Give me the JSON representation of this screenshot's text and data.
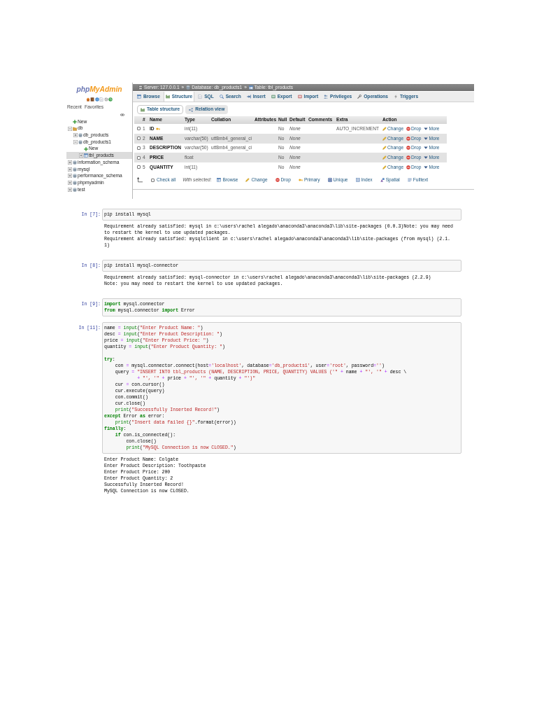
{
  "phpmyadmin": {
    "logo": {
      "prefix": "php",
      "name": "MyAdmin"
    },
    "panel_tabs": [
      "Recent",
      "Favorites"
    ],
    "tree": [
      {
        "kind": "new",
        "label": "New",
        "selected": false
      },
      {
        "kind": "group",
        "label": "db",
        "expanded": true,
        "selected": false,
        "children": [
          {
            "kind": "database",
            "label": "db_products",
            "expanded": false,
            "selected": false
          },
          {
            "kind": "database",
            "label": "db_products1",
            "expanded": true,
            "selected": false,
            "children": [
              {
                "kind": "new",
                "label": "New",
                "selected": false
              },
              {
                "kind": "table",
                "label": "tbl_products",
                "expanded": false,
                "selected": true
              }
            ]
          }
        ]
      },
      {
        "kind": "database",
        "label": "information_schema",
        "expanded": false,
        "selected": false
      },
      {
        "kind": "database",
        "label": "mysql",
        "expanded": false,
        "selected": false
      },
      {
        "kind": "database",
        "label": "performance_schema",
        "expanded": false,
        "selected": false
      },
      {
        "kind": "database",
        "label": "phpmyadmin",
        "expanded": false,
        "selected": false
      },
      {
        "kind": "database",
        "label": "test",
        "expanded": false,
        "selected": false
      }
    ],
    "breadcrumb": [
      {
        "kind": "server",
        "text": "Server: 127.0.0.1"
      },
      {
        "kind": "separator",
        "text": "»"
      },
      {
        "kind": "database",
        "text": "Database: db_products1"
      },
      {
        "kind": "separator",
        "text": "»"
      },
      {
        "kind": "table",
        "text": "Table: tbl_products"
      }
    ],
    "tabs": [
      {
        "label": "Browse",
        "selected": false
      },
      {
        "label": "Structure",
        "selected": true
      },
      {
        "label": "SQL",
        "selected": false
      },
      {
        "label": "Search",
        "selected": false
      },
      {
        "label": "Insert",
        "selected": false
      },
      {
        "label": "Export",
        "selected": false
      },
      {
        "label": "Import",
        "selected": false
      },
      {
        "label": "Privileges",
        "selected": false
      },
      {
        "label": "Operations",
        "selected": false
      },
      {
        "label": "Triggers",
        "selected": false
      }
    ],
    "subtabs": [
      {
        "label": "Table structure",
        "selected": true
      },
      {
        "label": "Relation view",
        "selected": false
      }
    ],
    "table": {
      "columns": [
        "#",
        "Name",
        "Type",
        "Collation",
        "Attributes",
        "Null",
        "Default",
        "Comments",
        "Extra",
        "Action"
      ],
      "rows": [
        {
          "checked": false,
          "number": "1",
          "name": "ID",
          "primary_key": true,
          "type": "int(11)",
          "null": "No",
          "default": "None",
          "extra": "AUTO_INCREMENT",
          "actions": [
            "Change",
            "Drop",
            "More"
          ]
        },
        {
          "checked": false,
          "number": "2",
          "name": "NAME",
          "primary_key": false,
          "type": "varchar(50)",
          "collation": "utf8mb4_general_ci",
          "null": "No",
          "default": "None",
          "actions": [
            "Change",
            "Drop",
            "More"
          ]
        },
        {
          "checked": false,
          "number": "3",
          "name": "DESCRIPTION",
          "primary_key": false,
          "type": "varchar(50)",
          "collation": "utf8mb4_general_ci",
          "null": "No",
          "default": "None",
          "actions": [
            "Change",
            "Drop",
            "More"
          ]
        },
        {
          "checked": false,
          "number": "4",
          "name": "PRICE",
          "primary_key": false,
          "type": "float",
          "null": "No",
          "default": "None",
          "actions": [
            "Change",
            "Drop",
            "More"
          ]
        },
        {
          "checked": false,
          "number": "5",
          "name": "QUANTITY",
          "primary_key": false,
          "type": "int(11)",
          "null": "No",
          "default": "None",
          "actions": [
            "Change",
            "Drop",
            "More"
          ]
        }
      ]
    },
    "footer": {
      "checked": false,
      "check_all": "Check all",
      "with_selected": "With selected:",
      "actions": [
        "Browse",
        "Change",
        "Drop",
        "Primary",
        "Unique",
        "Index",
        "Spatial",
        "Fulltext"
      ]
    }
  },
  "notebook": {
    "cells": [
      {
        "prompt": "In [7]:",
        "blocks": [
          {
            "lines": [
              [
                {
                  "kind": "plain",
                  "text": "pip install mysql"
                }
              ]
            ]
          }
        ],
        "output": [
          "Requirement already satisfied: mysql in c:\\users\\rachel alegado\\anaconda3\\anaconda3\\lib\\site-packages (0.0.3)Note: you may need",
          "to restart the kernel to use updated packages.",
          "Requirement already satisfied: mysqlclient in c:\\users\\rachel alegado\\anaconda3\\anaconda3\\lib\\site-packages (from mysql) (2.1.",
          "1)"
        ]
      },
      {
        "prompt": "In [8]:",
        "blocks": [
          {
            "lines": [
              [
                {
                  "kind": "plain",
                  "text": "pip install mysql-connector"
                }
              ]
            ]
          }
        ],
        "output": [
          "Requirement already satisfied: mysql-connector in c:\\users\\rachel alegado\\anaconda3\\anaconda3\\lib\\site-packages (2.2.9)",
          "Note: you may need to restart the kernel to use updated packages."
        ]
      },
      {
        "prompt": "In [9]:",
        "blocks": [
          {
            "lines": [
              [
                {
                  "kind": "keyword",
                  "text": "import"
                },
                {
                  "kind": "plain",
                  "text": " mysql.connector"
                }
              ],
              [
                {
                  "kind": "keyword",
                  "text": "from"
                },
                {
                  "kind": "plain",
                  "text": " mysql.connector "
                },
                {
                  "kind": "keyword",
                  "text": "import"
                },
                {
                  "kind": "plain",
                  "text": " Error"
                }
              ]
            ]
          }
        ]
      },
      {
        "prompt": "In [11]:",
        "blocks": [
          {
            "lines": [
              [
                {
                  "kind": "plain",
                  "text": "name "
                },
                {
                  "kind": "operator",
                  "text": "="
                },
                {
                  "kind": "builtin",
                  "text": " input"
                },
                {
                  "kind": "plain",
                  "text": "("
                },
                {
                  "kind": "string",
                  "text": "\"Enter Product Name: \""
                },
                {
                  "kind": "plain",
                  "text": ")"
                }
              ],
              [
                {
                  "kind": "plain",
                  "text": "desc "
                },
                {
                  "kind": "operator",
                  "text": "="
                },
                {
                  "kind": "builtin",
                  "text": " input"
                },
                {
                  "kind": "plain",
                  "text": "("
                },
                {
                  "kind": "string",
                  "text": "\"Enter Product Description: \""
                },
                {
                  "kind": "plain",
                  "text": ")"
                }
              ],
              [
                {
                  "kind": "plain",
                  "text": "price "
                },
                {
                  "kind": "operator",
                  "text": "="
                },
                {
                  "kind": "builtin",
                  "text": " input"
                },
                {
                  "kind": "plain",
                  "text": "("
                },
                {
                  "kind": "string",
                  "text": "\"Enter Product Price: \""
                },
                {
                  "kind": "plain",
                  "text": ")"
                }
              ],
              [
                {
                  "kind": "plain",
                  "text": "quantity "
                },
                {
                  "kind": "operator",
                  "text": "="
                },
                {
                  "kind": "builtin",
                  "text": " input"
                },
                {
                  "kind": "plain",
                  "text": "("
                },
                {
                  "kind": "string",
                  "text": "\"Enter Product Quantity: \""
                },
                {
                  "kind": "plain",
                  "text": ")"
                }
              ]
            ]
          },
          {
            "lines": [
              [
                {
                  "kind": "keyword",
                  "text": "try"
                },
                {
                  "kind": "plain",
                  "text": ":"
                }
              ],
              [
                {
                  "kind": "plain",
                  "text": "    con "
                },
                {
                  "kind": "operator",
                  "text": "="
                },
                {
                  "kind": "plain",
                  "text": " mysql.connector.connect(host"
                },
                {
                  "kind": "operator",
                  "text": "="
                },
                {
                  "kind": "string",
                  "text": "'localhost'"
                },
                {
                  "kind": "plain",
                  "text": ", database"
                },
                {
                  "kind": "operator",
                  "text": "="
                },
                {
                  "kind": "string",
                  "text": "'db_products1'"
                },
                {
                  "kind": "plain",
                  "text": ", user"
                },
                {
                  "kind": "operator",
                  "text": "="
                },
                {
                  "kind": "string",
                  "text": "'root'"
                },
                {
                  "kind": "plain",
                  "text": ", password"
                },
                {
                  "kind": "operator",
                  "text": "="
                },
                {
                  "kind": "string",
                  "text": "''"
                },
                {
                  "kind": "plain",
                  "text": ")"
                }
              ],
              [
                {
                  "kind": "plain",
                  "text": "    query "
                },
                {
                  "kind": "operator",
                  "text": "="
                },
                {
                  "kind": "string",
                  "text": " \"INSERT INTO tbl_products (NAME, DESCRIPTION, PRICE, QUANTITY) VALUES ('\""
                },
                {
                  "kind": "operator",
                  "text": " +"
                },
                {
                  "kind": "plain",
                  "text": " name "
                },
                {
                  "kind": "operator",
                  "text": "+"
                },
                {
                  "kind": "string",
                  "text": " \"', '\""
                },
                {
                  "kind": "operator",
                  "text": " +"
                },
                {
                  "kind": "plain",
                  "text": " desc \\"
                }
              ],
              [
                {
                  "kind": "operator",
                  "text": "            +"
                },
                {
                  "kind": "string",
                  "text": " \"', '\""
                },
                {
                  "kind": "operator",
                  "text": " +"
                },
                {
                  "kind": "plain",
                  "text": " price "
                },
                {
                  "kind": "operator",
                  "text": "+"
                },
                {
                  "kind": "string",
                  "text": " \"', '\""
                },
                {
                  "kind": "operator",
                  "text": " +"
                },
                {
                  "kind": "plain",
                  "text": " quantity "
                },
                {
                  "kind": "operator",
                  "text": "+"
                },
                {
                  "kind": "string",
                  "text": " \"')\""
                }
              ],
              [
                {
                  "kind": "plain",
                  "text": "    cur "
                },
                {
                  "kind": "operator",
                  "text": "="
                },
                {
                  "kind": "plain",
                  "text": " con.cursor()"
                }
              ],
              [
                {
                  "kind": "plain",
                  "text": "    cur.execute(query)"
                }
              ],
              [
                {
                  "kind": "plain",
                  "text": "    con.commit()"
                }
              ],
              [
                {
                  "kind": "plain",
                  "text": "    cur.close()"
                }
              ],
              [
                {
                  "kind": "builtin",
                  "text": "    print"
                },
                {
                  "kind": "plain",
                  "text": "("
                },
                {
                  "kind": "string",
                  "text": "\"Successfully Inserted Record!\""
                },
                {
                  "kind": "plain",
                  "text": ")"
                }
              ],
              [
                {
                  "kind": "keyword",
                  "text": "except"
                },
                {
                  "kind": "plain",
                  "text": " Error "
                },
                {
                  "kind": "keyword",
                  "text": "as"
                },
                {
                  "kind": "plain",
                  "text": " error:"
                }
              ],
              [
                {
                  "kind": "builtin",
                  "text": "    print"
                },
                {
                  "kind": "plain",
                  "text": "("
                },
                {
                  "kind": "string",
                  "text": "\"Insert data failed {}\""
                },
                {
                  "kind": "plain",
                  "text": ".format(error))"
                }
              ],
              [
                {
                  "kind": "keyword",
                  "text": "finally"
                },
                {
                  "kind": "plain",
                  "text": ":"
                }
              ],
              [
                {
                  "kind": "keyword",
                  "text": "    if"
                },
                {
                  "kind": "plain",
                  "text": " con.is_connected():"
                }
              ],
              [
                {
                  "kind": "plain",
                  "text": "        con.close()"
                }
              ],
              [
                {
                  "kind": "builtin",
                  "text": "        print"
                },
                {
                  "kind": "plain",
                  "text": "("
                },
                {
                  "kind": "string",
                  "text": "\"MySQL Connection is now CLOSED.\""
                },
                {
                  "kind": "plain",
                  "text": ")"
                }
              ]
            ]
          }
        ],
        "output": [
          "Enter Product Name: Colgate",
          "Enter Product Description: Toothpaste",
          "Enter Product Price: 200",
          "Enter Product Quantity: 2",
          "Successfully Inserted Record!",
          "MySQL Connection is now CLOSED."
        ]
      }
    ]
  }
}
